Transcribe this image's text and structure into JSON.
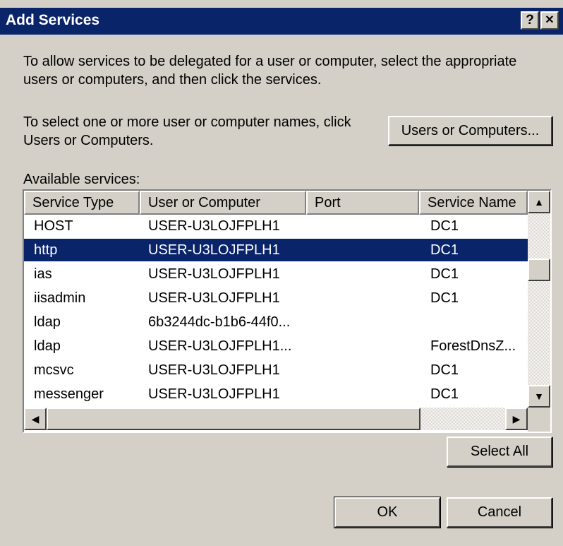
{
  "window": {
    "title": "Add Services",
    "help_label": "?",
    "close_label": "✕"
  },
  "instructions": {
    "line1": "To allow services to be delegated for a user or computer, select the appropriate",
    "line2": "users or computers, and then click the services.",
    "select_line1": "To select one or more user or computer names, click",
    "select_line2": "Users or Computers."
  },
  "buttons": {
    "users_or_computers": "Users or Computers...",
    "select_all": "Select All",
    "ok": "OK",
    "cancel": "Cancel"
  },
  "list": {
    "label": "Available services:",
    "columns": [
      "Service Type",
      "User or Computer",
      "Port",
      "Service Name"
    ],
    "rows": [
      {
        "type": "HOST",
        "user": "USER-U3LOJFPLH1",
        "port": "",
        "name": "DC1",
        "selected": false
      },
      {
        "type": "http",
        "user": "USER-U3LOJFPLH1",
        "port": "",
        "name": "DC1",
        "selected": true
      },
      {
        "type": "ias",
        "user": "USER-U3LOJFPLH1",
        "port": "",
        "name": "DC1",
        "selected": false
      },
      {
        "type": "iisadmin",
        "user": "USER-U3LOJFPLH1",
        "port": "",
        "name": "DC1",
        "selected": false
      },
      {
        "type": "ldap",
        "user": "6b3244dc-b1b6-44f0...",
        "port": "",
        "name": "",
        "selected": false
      },
      {
        "type": "ldap",
        "user": "USER-U3LOJFPLH1...",
        "port": "",
        "name": "ForestDnsZ...",
        "selected": false
      },
      {
        "type": "mcsvc",
        "user": "USER-U3LOJFPLH1",
        "port": "",
        "name": "DC1",
        "selected": false
      },
      {
        "type": "messenger",
        "user": "USER-U3LOJFPLH1",
        "port": "",
        "name": "DC1",
        "selected": false
      }
    ],
    "scroll": {
      "up": "▲",
      "down": "▼",
      "left": "◀",
      "right": "▶"
    }
  }
}
